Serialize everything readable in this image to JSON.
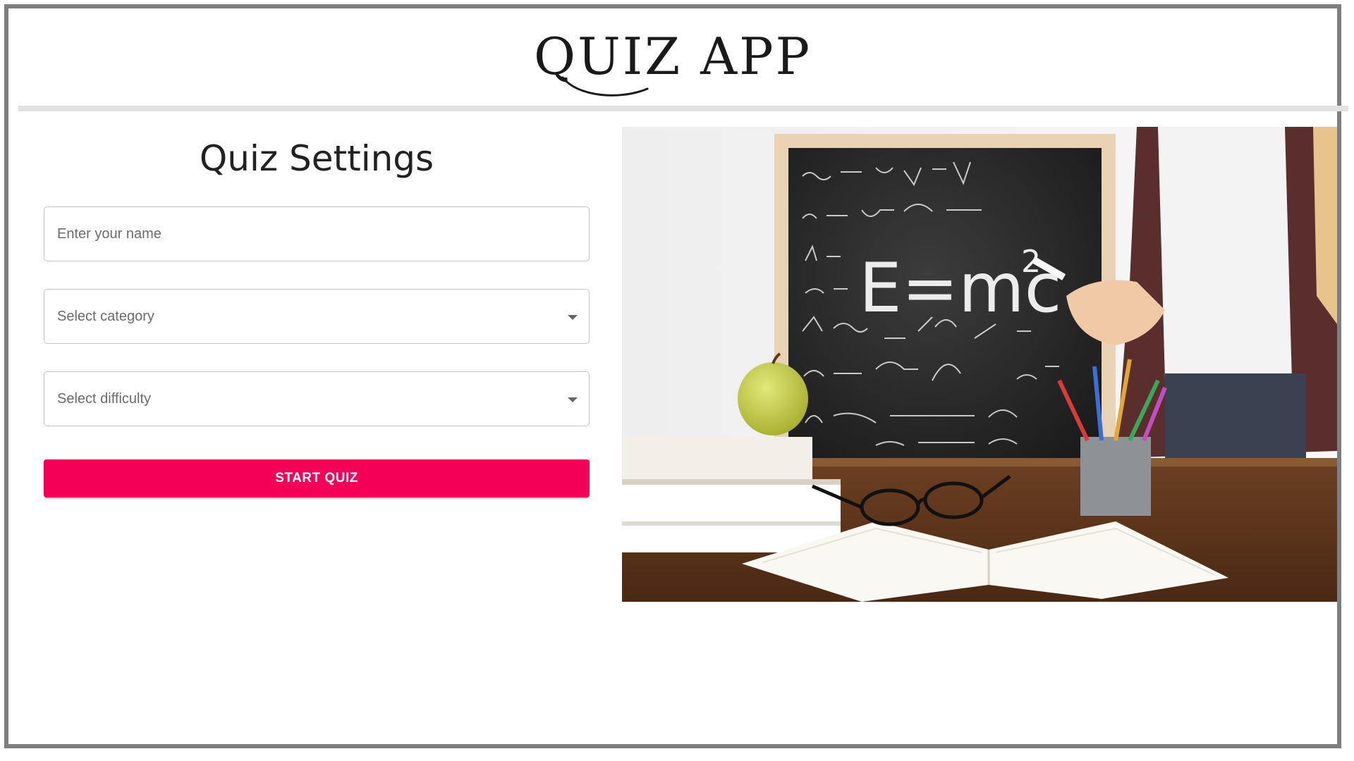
{
  "header": {
    "title": "QUIZ APP"
  },
  "settings": {
    "title": "Quiz Settings",
    "name_placeholder": "Enter your name",
    "category_placeholder": "Select category",
    "difficulty_placeholder": "Select difficulty",
    "start_label": "START QUIZ"
  },
  "hero": {
    "chalk_formula": "E=mc",
    "chalk_exponent": "2"
  },
  "colors": {
    "accent": "#f50057",
    "frame": "#7f7f7f",
    "divider": "#e1e1e1"
  }
}
